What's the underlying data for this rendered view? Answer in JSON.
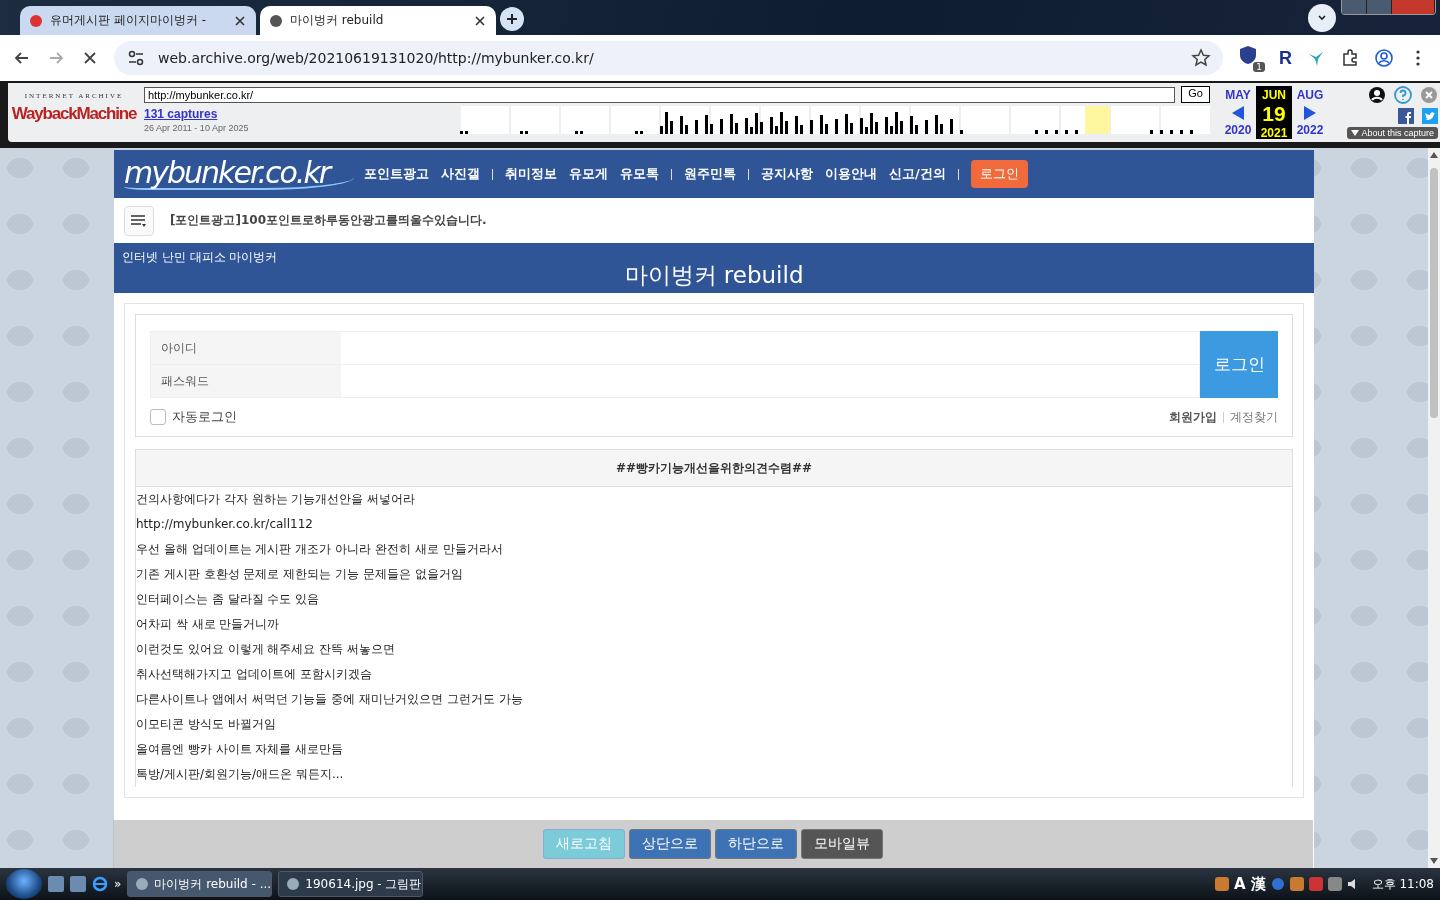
{
  "browser": {
    "tabs": [
      {
        "title": "유머게시판 페이지마이벙커 -",
        "selected": false
      },
      {
        "title": "마이벙커 rebuild",
        "selected": true
      }
    ],
    "url": "web.archive.org/web/20210619131020/http://mybunker.co.kr/",
    "extension_badge": "1",
    "extension_letter": "R"
  },
  "wayback": {
    "brand_top": "INTERNET ARCHIVE",
    "brand": "WaybackMachine",
    "url": "http://mybunker.co.kr/",
    "go": "Go",
    "captures": "131 captures",
    "range": "26 Apr 2011 - 10 Apr 2025",
    "months": [
      {
        "label": "MAY",
        "year": "2020",
        "selected": false
      },
      {
        "label": "JUN",
        "day": "19",
        "year": "2021",
        "selected": true
      },
      {
        "label": "AUG",
        "year": "2022",
        "selected": false
      }
    ],
    "about": "About this capture"
  },
  "site": {
    "logo": "mybunker.co.kr",
    "nav": [
      [
        "포인트광고",
        "사진갤"
      ],
      [
        "취미정보",
        "유모게",
        "유모톡"
      ],
      [
        "원주민톡"
      ],
      [
        "공지사항",
        "이용안내",
        "신고/건의"
      ]
    ],
    "login_button": "로그인",
    "notice": "[포인트광고]100포인트로하루동안광고를띄울수있습니다.",
    "tagline": "인터넷 난민 대피소 마이벙커",
    "title": "마이벙커 rebuild",
    "login_form": {
      "id_label": "아이디",
      "password_label": "패스워드",
      "submit": "로그인",
      "auto_login": {
        "label": "자동로그인",
        "checked": false
      },
      "links": [
        "회원가입",
        "계정찾기"
      ]
    },
    "post": {
      "title": "##빵카기능개선을위한의견수렴##",
      "lines": [
        "건의사항에다가 각자 원하는 기능개선안을 써넣어라",
        "http://mybunker.co.kr/call112",
        "우선 올해 업데이트는 게시판 개조가 아니라 완전히 새로 만들거라서",
        "기존 게시판 호환성 문제로 제한되는 기능 문제들은 없을거임",
        "인터페이스는 좀 달라질 수도 있음",
        "어차피 싹 새로 만들거니까",
        "이런것도 있어요 이렇게 해주세요 잔뜩 써놓으면",
        "취사선택해가지고 업데이트에 포함시키겠슴",
        "다른사이트나 앱에서 써먹던 기능들 중에 재미난거있으면 그런거도 가능",
        "이모티콘 방식도 바뀔거임",
        "올여름엔 빵카 사이트 자체를 새로만듬",
        "톡방/게시판/회원기능/애드온 뭐든지..."
      ]
    },
    "float_buttons": [
      {
        "label": "새로고침",
        "kind": "light"
      },
      {
        "label": "상단으로",
        "kind": "blue"
      },
      {
        "label": "하단으로",
        "kind": "blue"
      },
      {
        "label": "모바일뷰",
        "kind": "dark"
      }
    ]
  },
  "taskbar": {
    "chevron": "»",
    "windows": [
      {
        "title": "마이벙커 rebuild - ...",
        "selected": true
      },
      {
        "title": "190614.jpg - 그림판",
        "selected": false
      }
    ],
    "ime": [
      "A",
      "漢"
    ],
    "clock": "오후 11:08"
  }
}
